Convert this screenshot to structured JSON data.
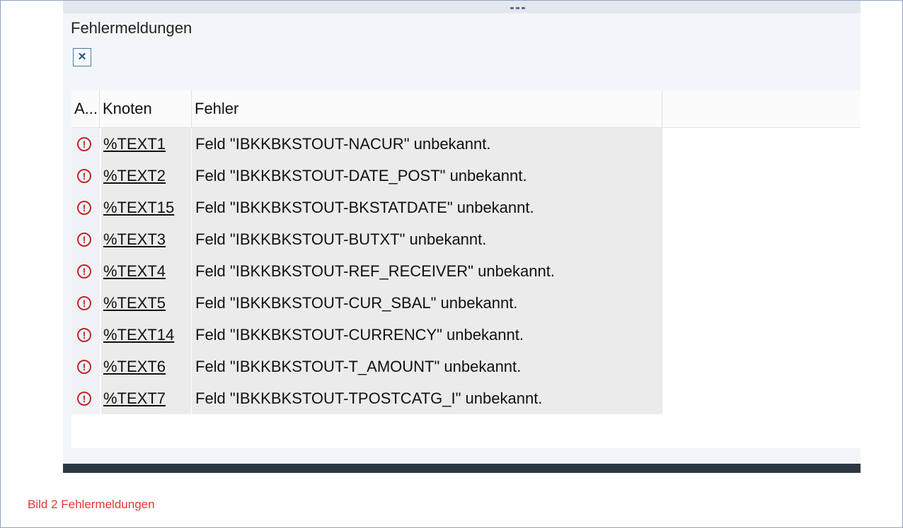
{
  "panel": {
    "title": "Fehlermeldungen",
    "close_icon": "close-icon",
    "grip_icon": "drag-grip-icon"
  },
  "table": {
    "columns": [
      "A...",
      "Knoten",
      "Fehler"
    ],
    "rows": [
      {
        "icon": "error-icon",
        "knoten": "%TEXT1",
        "fehler": "Feld \"IBKKBKSTOUT-NACUR\" unbekannt."
      },
      {
        "icon": "error-icon",
        "knoten": "%TEXT2",
        "fehler": "Feld \"IBKKBKSTOUT-DATE_POST\" unbekannt."
      },
      {
        "icon": "error-icon",
        "knoten": "%TEXT15",
        "fehler": "Feld \"IBKKBKSTOUT-BKSTATDATE\" unbekannt."
      },
      {
        "icon": "error-icon",
        "knoten": "%TEXT3",
        "fehler": "Feld \"IBKKBKSTOUT-BUTXT\" unbekannt."
      },
      {
        "icon": "error-icon",
        "knoten": "%TEXT4",
        "fehler": "Feld \"IBKKBKSTOUT-REF_RECEIVER\" unbekannt."
      },
      {
        "icon": "error-icon",
        "knoten": "%TEXT5",
        "fehler": "Feld \"IBKKBKSTOUT-CUR_SBAL\" unbekannt."
      },
      {
        "icon": "error-icon",
        "knoten": "%TEXT14",
        "fehler": "Feld \"IBKKBKSTOUT-CURRENCY\" unbekannt."
      },
      {
        "icon": "error-icon",
        "knoten": "%TEXT6",
        "fehler": "Feld \"IBKKBKSTOUT-T_AMOUNT\" unbekannt."
      },
      {
        "icon": "error-icon",
        "knoten": "%TEXT7",
        "fehler": "Feld \"IBKKBKSTOUT-TPOSTCATG_I\" unbekannt."
      }
    ]
  },
  "caption": "Bild 2 Fehlermeldungen",
  "colors": {
    "error": "#c0262d",
    "caption": "#e03a2f",
    "footer_bar": "#2d3742"
  }
}
